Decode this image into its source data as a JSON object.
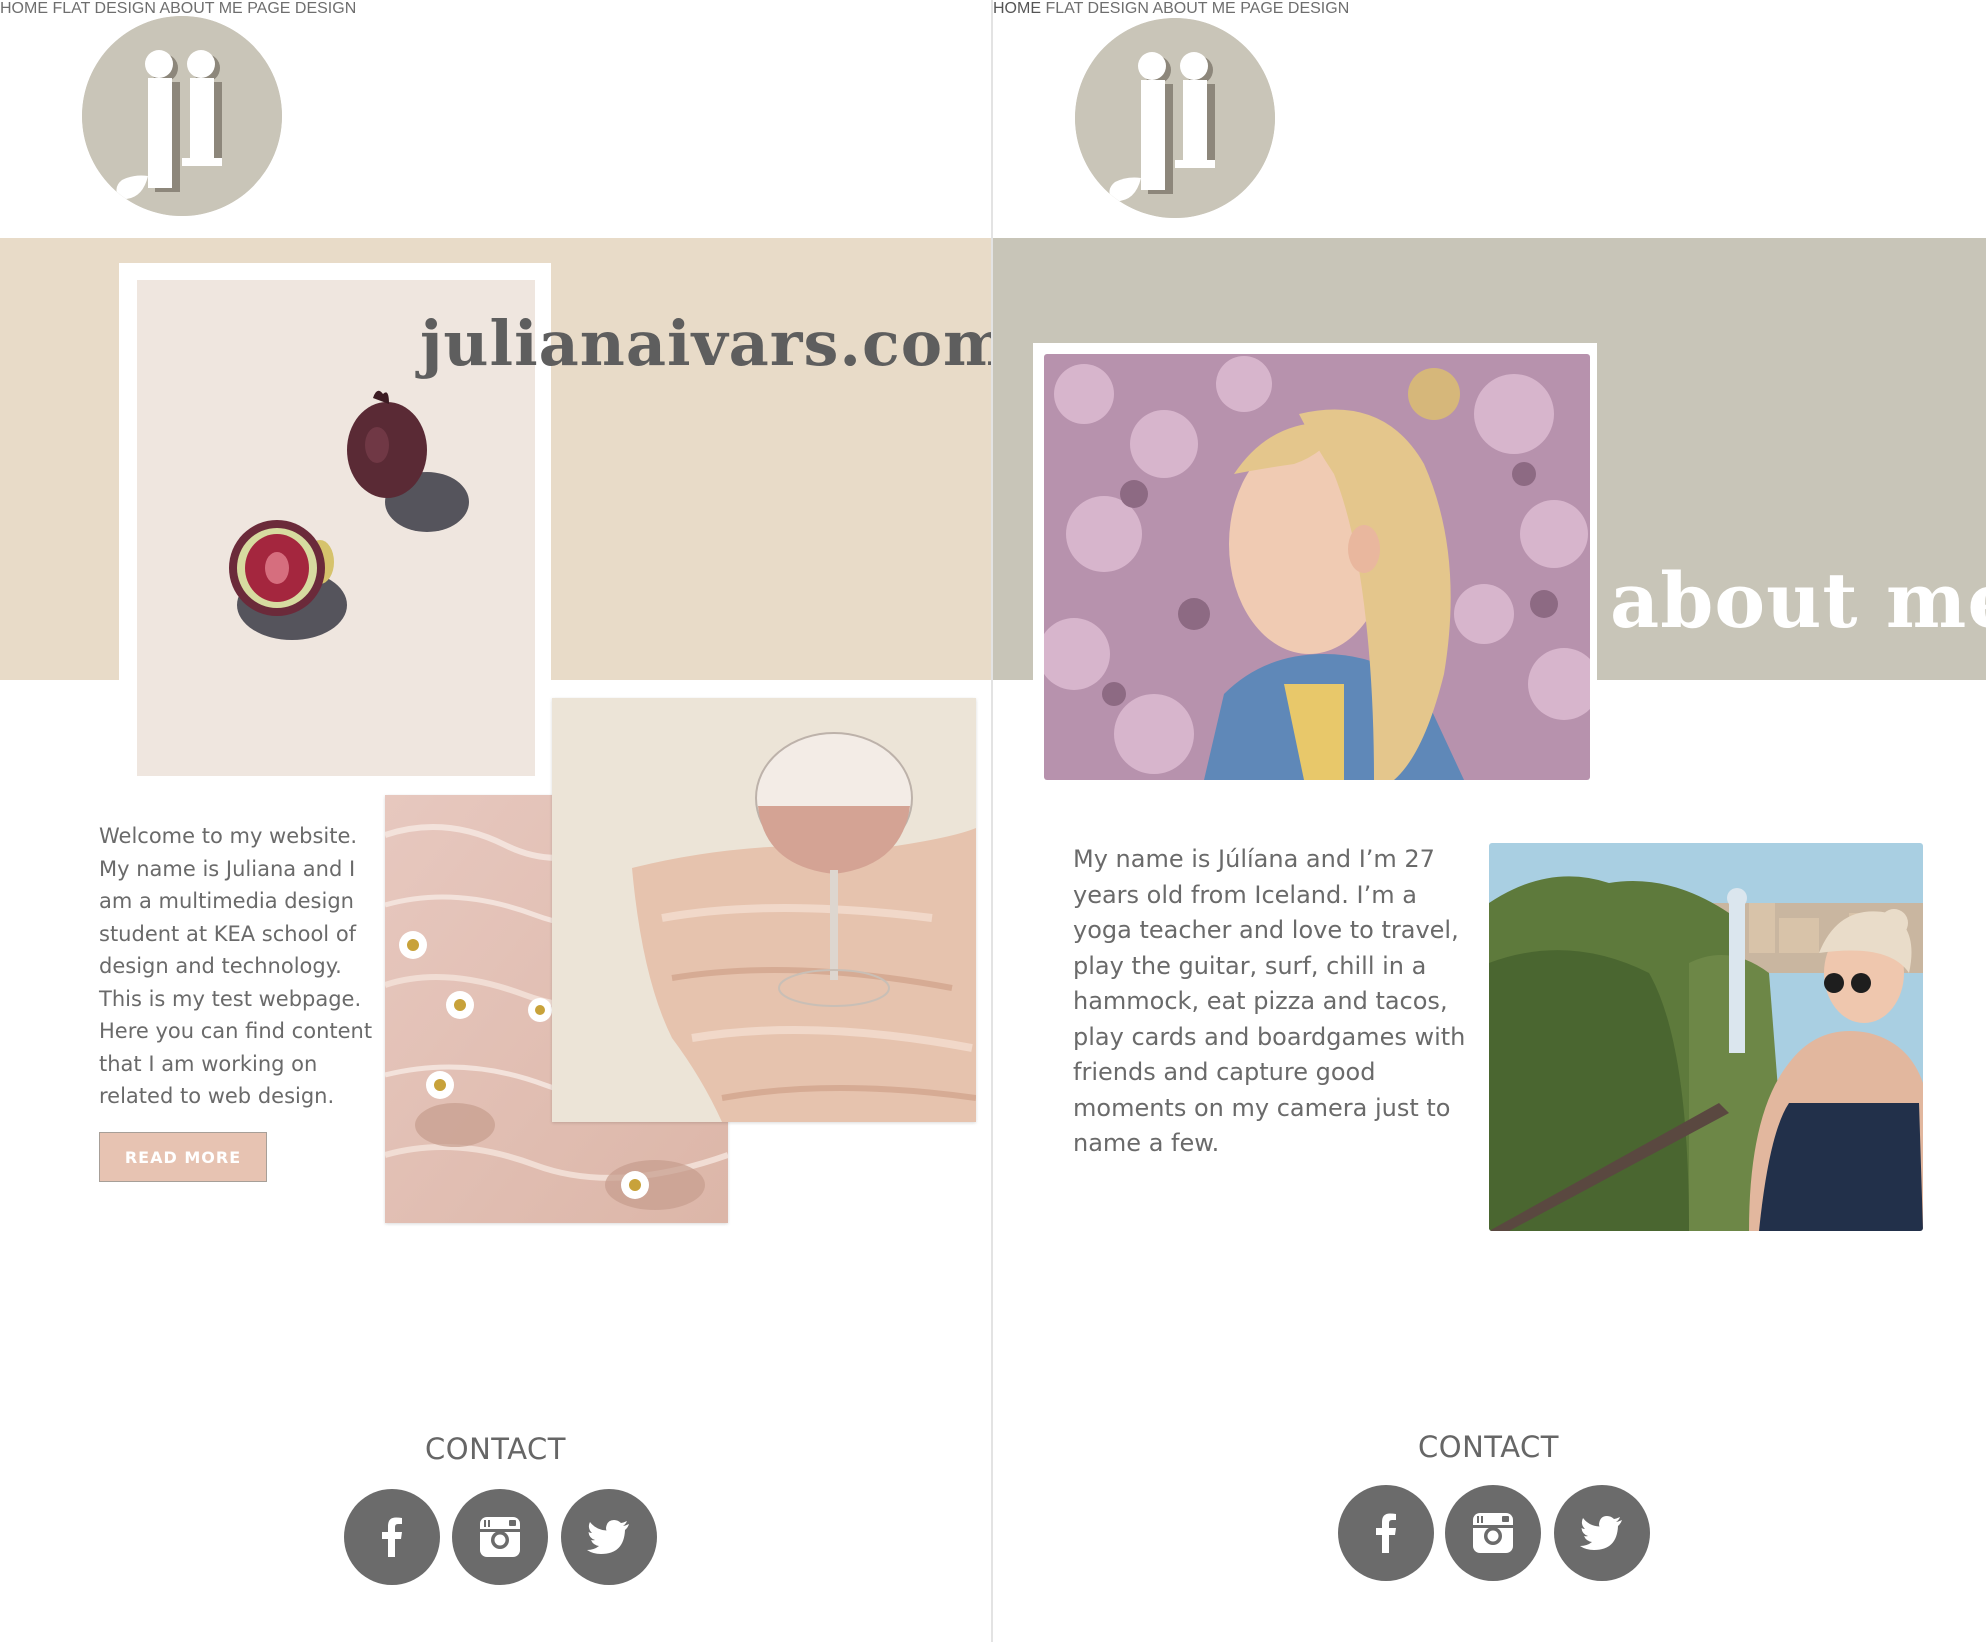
{
  "left_page": {
    "logo_text": "ji",
    "nav": [
      "HOME",
      "FLAT DESIGN",
      "ABOUT ME",
      "PAGE DESIGN"
    ],
    "site_title": "julianaivars.com",
    "intro_text": "Welcome to my website. My name is Juliana and I am a multimedia design student at KEA school of design and technology. This is my test webpage. Here you can find content that I am working on related to web design.",
    "read_more_label": "READ MORE",
    "contact_title": "CONTACT",
    "social_icons": [
      "facebook-icon",
      "instagram-icon",
      "twitter-icon"
    ]
  },
  "right_page": {
    "logo_text": "ji",
    "nav": [
      "HOME",
      "FLAT DESIGN",
      "ABOUT ME",
      "PAGE DESIGN"
    ],
    "section_title": "about me",
    "about_text": "My name is Júlíana and I’m 27 years old from Iceland. I’m a yoga teacher and love to travel, play the guitar, surf, chill in a hammock, eat pizza and tacos, play cards and boardgames with friends and capture good moments on my camera just to name a few.",
    "contact_title": "CONTACT",
    "social_icons": [
      "facebook-icon",
      "instagram-icon",
      "twitter-icon"
    ]
  },
  "colors": {
    "band_left": "#e8dbc8",
    "band_right": "#c8c5b8",
    "logo_circle": "#c9c5b8",
    "button": "#e7c3b2",
    "social_circle": "#6b6b6b",
    "text": "#6a6a6a"
  }
}
